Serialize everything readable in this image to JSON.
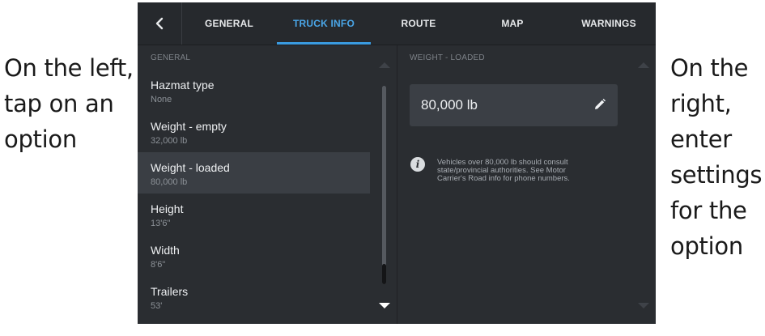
{
  "annotations": {
    "left": [
      "On the left,",
      "tap on an",
      "option"
    ],
    "right": [
      "On the",
      "right,",
      "enter",
      "settings",
      "for the",
      "option"
    ]
  },
  "tabs": [
    {
      "label": "GENERAL",
      "active": false
    },
    {
      "label": "TRUCK INFO",
      "active": true
    },
    {
      "label": "ROUTE",
      "active": false
    },
    {
      "label": "MAP",
      "active": false
    },
    {
      "label": "WARNINGS",
      "active": false
    }
  ],
  "left_panel": {
    "header": "GENERAL",
    "options": [
      {
        "label": "Hazmat type",
        "value": "None",
        "selected": false
      },
      {
        "label": "Weight - empty",
        "value": "32,000 lb",
        "selected": false
      },
      {
        "label": "Weight - loaded",
        "value": "80,000 lb",
        "selected": true
      },
      {
        "label": "Height",
        "value": "13'6\"",
        "selected": false
      },
      {
        "label": "Width",
        "value": "8'6\"",
        "selected": false
      },
      {
        "label": "Trailers",
        "value": "53'",
        "selected": false
      }
    ]
  },
  "right_panel": {
    "header": "WEIGHT - LOADED",
    "input_value": "80,000 lb",
    "info_lines": [
      "Vehicles over 80,000 lb should consult",
      "state/provincial authorities. See Motor",
      "Carrier's Road info for phone numbers."
    ]
  },
  "icons": {
    "back": "chevron-left-icon",
    "edit": "pencil-icon",
    "info": "info-icon",
    "scroll_up": "triangle-up-icon",
    "scroll_down": "triangle-down-icon"
  },
  "colors": {
    "panel_bg": "#2a2d31",
    "selected_row": "#3a3e44",
    "accent": "#4aa6e8"
  }
}
